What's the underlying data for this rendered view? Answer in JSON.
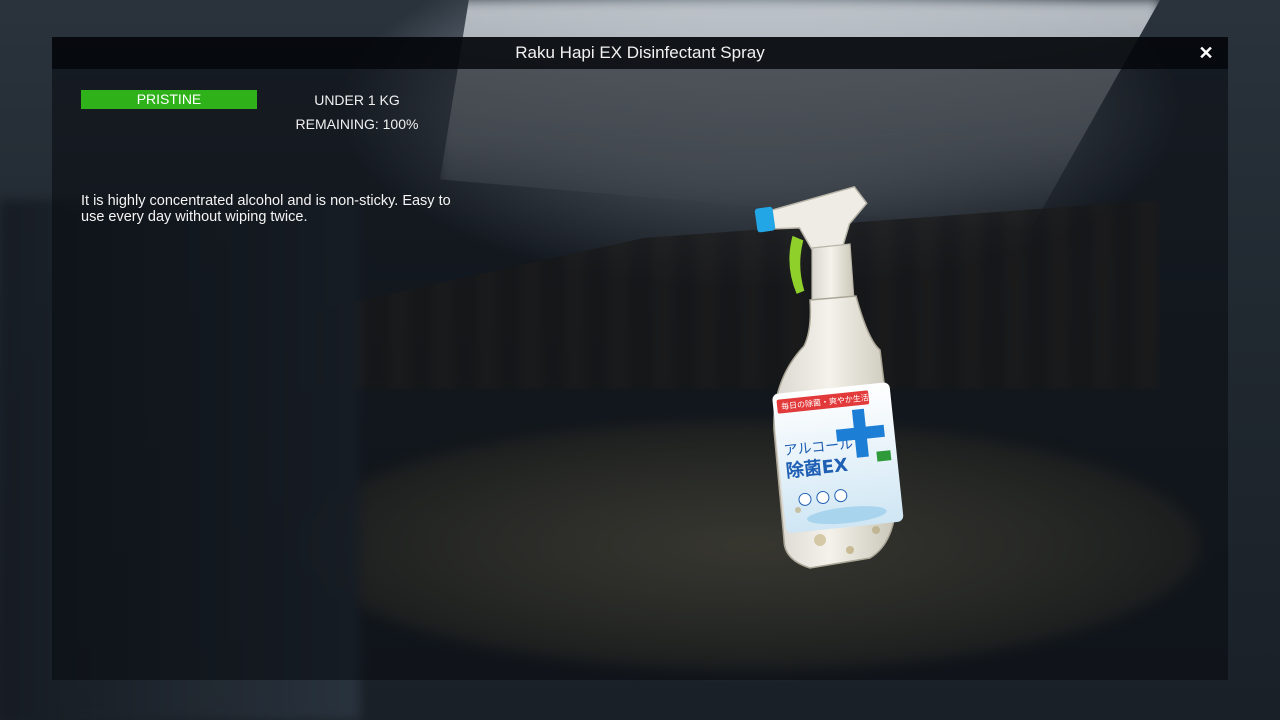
{
  "item": {
    "title": "Raku Hapi EX Disinfectant Spray",
    "close_icon": "close-icon",
    "condition": "PRISTINE",
    "condition_color": "#2fb11a",
    "weight": "UNDER 1 KG",
    "remaining": "REMAINING: 100%",
    "description": "It is highly concentrated alcohol and is non-sticky. Easy to use every day without wiping twice.",
    "bottle_label": {
      "top_banner": "毎日の除菌・爽やか生活。",
      "line1": "アルコール",
      "line2": "除菌EX"
    }
  }
}
